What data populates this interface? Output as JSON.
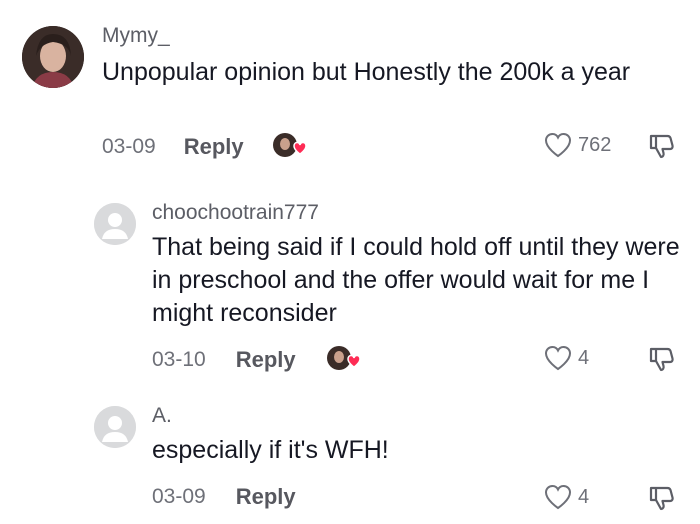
{
  "comments": [
    {
      "username": "Mymy_",
      "text": "Unpopular opinion but Honestly the 200k a year",
      "date": "03-09",
      "reply_label": "Reply",
      "likes": "762",
      "liked_by_creator": true,
      "avatar": "photo"
    },
    {
      "username": "choochootrain777",
      "text": "That being said if I could hold off until they were in preschool and the offer would wait for me I might reconsider",
      "date": "03-10",
      "reply_label": "Reply",
      "likes": "4",
      "liked_by_creator": true,
      "avatar": "default"
    },
    {
      "username": "A.",
      "text": "especially if it's WFH!",
      "date": "03-09",
      "reply_label": "Reply",
      "likes": "4",
      "liked_by_creator": false,
      "avatar": "default"
    }
  ],
  "colors": {
    "text_primary": "#161823",
    "text_secondary": "#5c5e66",
    "heart_red": "#fe2c55",
    "default_avatar": "#d9dadc"
  },
  "icons": {
    "like": "heart-outline-icon",
    "dislike": "thumbs-down-icon",
    "creator_liked": "creator-heart-badge-icon"
  }
}
